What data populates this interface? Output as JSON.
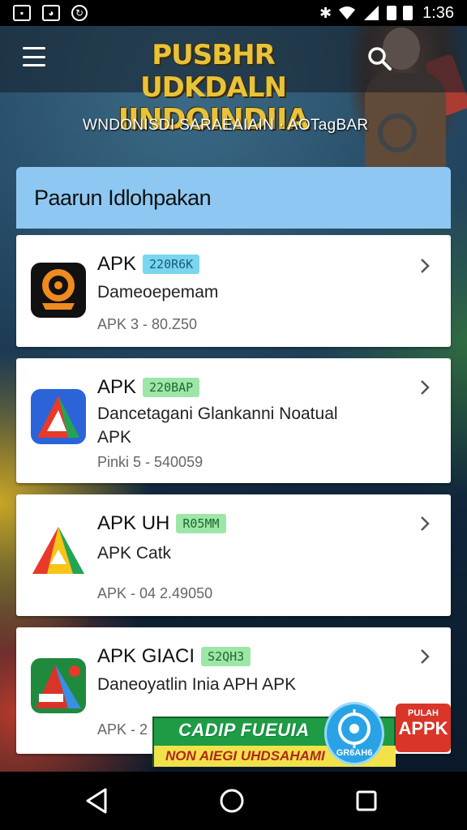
{
  "status_bar": {
    "time": "1:36",
    "left_icons": [
      "image-icon",
      "cat-icon",
      "sync-icon"
    ],
    "right_icons": [
      "bluetooth-icon",
      "wifi-icon",
      "signal-icon",
      "battery-icon"
    ]
  },
  "header": {
    "title_line1": "PUSBHR UDKDALN",
    "title_line2": "IINDOINDIIA",
    "subtitle": "WNDONISDI SARAEAIAIN · AOTagBAR"
  },
  "panel": {
    "title": "Paarun Idlohpakan"
  },
  "apps": [
    {
      "name": "APK",
      "badge": "220R6K",
      "badge_bg": "#79d6ef",
      "badge_color": "#1b5a7a",
      "description": "Dameoepemam",
      "meta": "APK 3 - 80.Z50"
    },
    {
      "name": "APK",
      "badge": "220BAP",
      "badge_bg": "#9ee6a8",
      "badge_color": "#1b6b2e",
      "description": "Dancetagani Glankanni Noatual APK",
      "meta": "Pinki 5 - 540059"
    },
    {
      "name": "APK UH",
      "badge": "R05MM",
      "badge_bg": "#9ee6a8",
      "badge_color": "#1b6b2e",
      "description": "APK Catk",
      "meta": "APK - 04 2.49050"
    },
    {
      "name": "APK GIACI",
      "badge": "S2QH3",
      "badge_bg": "#9ee6a8",
      "badge_color": "#1b6b2e",
      "description": "Daneoyatlin Inia APH APK",
      "meta": "APK - 2"
    }
  ],
  "ad": {
    "line1": "CADIP FUEUIA",
    "line2": "NON AIEGI UHDSAHAMI",
    "logo_text": "GR6AH6",
    "right_small": "PULAH",
    "right_big": "APPK"
  },
  "nav": [
    "back-icon",
    "home-icon",
    "recents-icon"
  ]
}
